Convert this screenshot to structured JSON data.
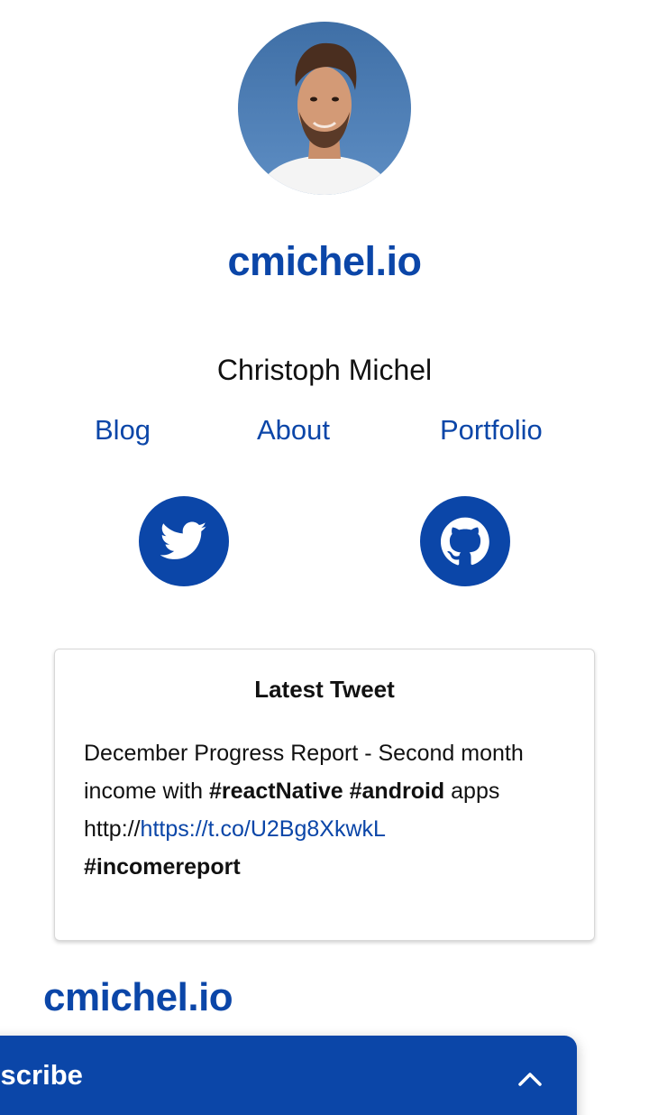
{
  "header": {
    "avatar_alt": "Christoph Michel avatar",
    "site_title": "cmichel.io",
    "author_name": "Christoph Michel"
  },
  "nav": {
    "items": [
      {
        "label": "Blog"
      },
      {
        "label": "About"
      },
      {
        "label": "Portfolio"
      }
    ]
  },
  "social": {
    "twitter_icon": "twitter-icon",
    "github_icon": "github-icon"
  },
  "tweet": {
    "heading": "Latest Tweet",
    "text_1": "December Progress Report - Second month income with ",
    "hashtag_1": "#reactNative",
    "hashtag_2": "#android",
    "text_2": " apps http://",
    "link": "https://t.co/U2Bg8XkwkL",
    "hashtag_3": "#incomereport"
  },
  "footer": {
    "site_title": "cmichel.io"
  },
  "subscribe": {
    "label": "Subscribe",
    "toggle_icon": "chevron-up-icon"
  },
  "colors": {
    "accent": "#0b46a8",
    "text": "#111111",
    "background": "#ffffff"
  }
}
